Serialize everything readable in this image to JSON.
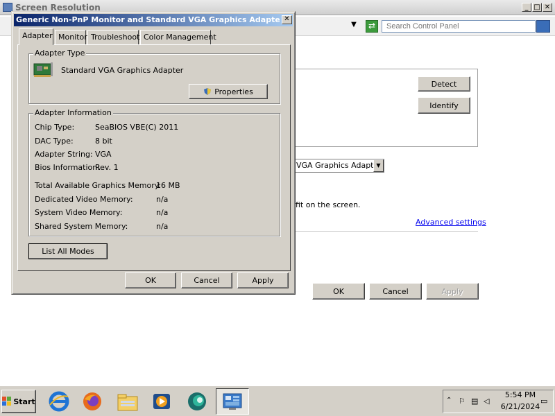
{
  "background_window": {
    "title": "Screen Resolution",
    "search_placeholder": "Search Control Panel",
    "detect_label": "Detect",
    "identify_label": "Identify",
    "display_select_value": "VGA Graphics Adapter",
    "fit_text": "fit on the screen.",
    "advanced_link": "Advanced settings",
    "ok_label": "OK",
    "cancel_label": "Cancel",
    "apply_label": "Apply"
  },
  "dialog": {
    "title": "Generic Non-PnP Monitor and Standard VGA Graphics Adapter Pr...",
    "close_label": "✕",
    "tabs": [
      {
        "label": "Adapter"
      },
      {
        "label": "Monitor"
      },
      {
        "label": "Troubleshoot"
      },
      {
        "label": "Color Management"
      }
    ],
    "active_tab": "Adapter",
    "adapter_type": {
      "legend": "Adapter Type",
      "name": "Standard VGA Graphics Adapter",
      "properties_label": "Properties"
    },
    "adapter_info": {
      "legend": "Adapter Information",
      "chip_type_label": "Chip Type:",
      "chip_type_value": "SeaBIOS VBE(C) 2011",
      "dac_type_label": "DAC Type:",
      "dac_type_value": "8 bit",
      "adapter_string_label": "Adapter String:",
      "adapter_string_value": "VGA",
      "bios_info_label": "Bios Information:",
      "bios_info_value": "Rev. 1",
      "total_mem_label": "Total Available Graphics Memory:",
      "total_mem_value": "16 MB",
      "dedicated_mem_label": "Dedicated Video Memory:",
      "dedicated_mem_value": "n/a",
      "system_mem_label": "System Video Memory:",
      "system_mem_value": "n/a",
      "shared_mem_label": "Shared System Memory:",
      "shared_mem_value": "n/a"
    },
    "list_all_modes_label": "List All Modes",
    "ok_label": "OK",
    "cancel_label": "Cancel",
    "apply_label": "Apply"
  },
  "taskbar": {
    "start_label": "Start",
    "icons": [
      "internet-explorer-icon",
      "firefox-icon",
      "file-explorer-icon",
      "media-player-icon",
      "orb-icon",
      "control-panel-icon"
    ],
    "clock_time": "5:54 PM",
    "clock_date": "6/21/2024"
  },
  "colors": {
    "title_gradient_start": "#0a246a",
    "title_gradient_end": "#a6caf0",
    "face": "#d4d0c8",
    "link": "#0000ee"
  }
}
